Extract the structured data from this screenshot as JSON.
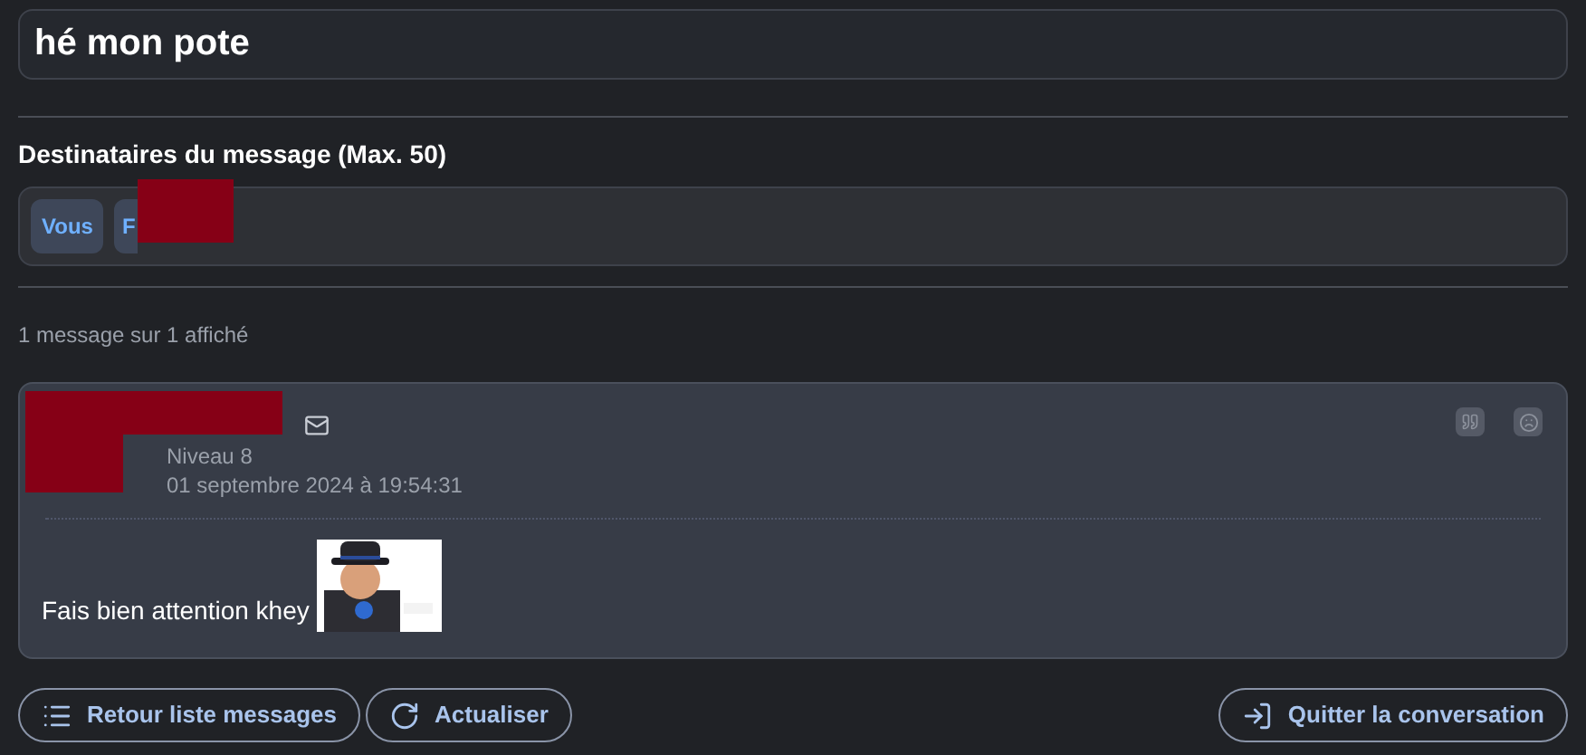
{
  "subject": {
    "value": "hé mon pote"
  },
  "recipients": {
    "label": "Destinataires du message (Max. 50)",
    "chips": [
      {
        "text": "Vous",
        "redacted": false
      },
      {
        "text": "F",
        "redacted": true
      }
    ]
  },
  "count": "1 message sur 1 affiché",
  "message": {
    "author_redacted": true,
    "level": "Niveau 8",
    "date": "01 septembre 2024 à 19:54:31",
    "body": "Fais bien attention khey"
  },
  "buttons": [
    {
      "kind": "list",
      "label": "Retour liste messages"
    },
    {
      "kind": "refresh",
      "label": "Actualiser"
    },
    {
      "kind": "leave",
      "label": "Quitter la conversation"
    }
  ]
}
